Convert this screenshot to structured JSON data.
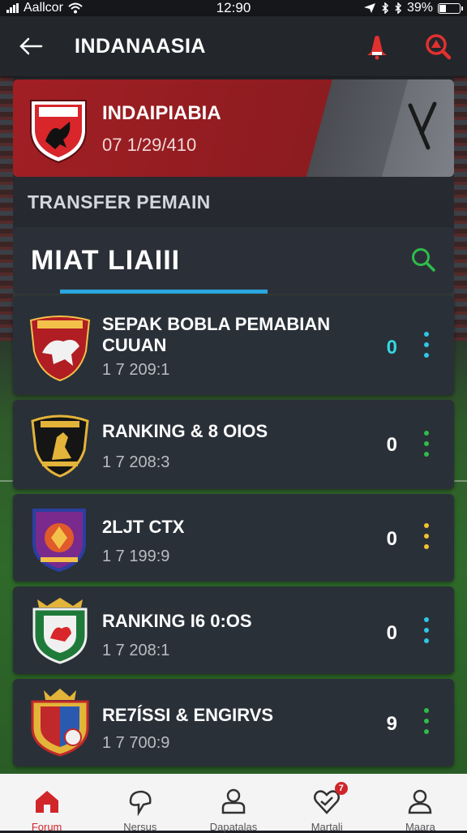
{
  "status_bar": {
    "carrier": "Aallcor",
    "time": "12:90",
    "battery": "39%"
  },
  "app_bar": {
    "title": "INDANAASIA"
  },
  "team_banner": {
    "name": "INDAIPIABIA",
    "date": "07 1/29/410"
  },
  "section": {
    "title": "TRANSFER PEMAIN"
  },
  "list_header": {
    "title": "MIAT LIAIII"
  },
  "rows": [
    {
      "title": "SEPAK BOBLA PEMABIAN CUUAN",
      "date": "1 7 209:1",
      "count": "0",
      "count_color": "#33d6e0",
      "dot_color": "#2fc6e8",
      "badge": "red-bull-crest-icon"
    },
    {
      "title": "RANKING & 8 OIOS",
      "date": "1 7 208:3",
      "count": "0",
      "count_color": "#ffffff",
      "dot_color": "#2ebd4a",
      "badge": "black-gold-crest-icon"
    },
    {
      "title": "2LJT CTX",
      "date": "1 7 199:9",
      "count": "0",
      "count_color": "#ffffff",
      "dot_color": "#f2c230",
      "badge": "blue-shield-crest-icon"
    },
    {
      "title": "RANKING I6 0:OS",
      "date": "1 7 208:1",
      "count": "0",
      "count_color": "#ffffff",
      "dot_color": "#2fc6e8",
      "badge": "green-shield-crest-icon"
    },
    {
      "title": "RE7ÍSSI & ENGIRVS",
      "date": "1 7 700:9",
      "count": "9",
      "count_color": "#ffffff",
      "dot_color": "#2ebd4a",
      "badge": "gold-crown-crest-icon"
    }
  ],
  "bottom_nav": [
    {
      "label": "Forum",
      "icon": "home-icon",
      "active": true
    },
    {
      "label": "Nersus",
      "icon": "signpost-icon",
      "active": false
    },
    {
      "label": "Dapatalas",
      "icon": "person-icon",
      "active": false
    },
    {
      "label": "Martali",
      "icon": "heart-badge-icon",
      "active": false,
      "badge": "7"
    },
    {
      "label": "Maara",
      "icon": "profile-icon",
      "active": false
    }
  ],
  "colors": {
    "accent_red": "#c8262b",
    "accent_blue": "#2aa6e0",
    "search_green": "#2ebd4a"
  }
}
